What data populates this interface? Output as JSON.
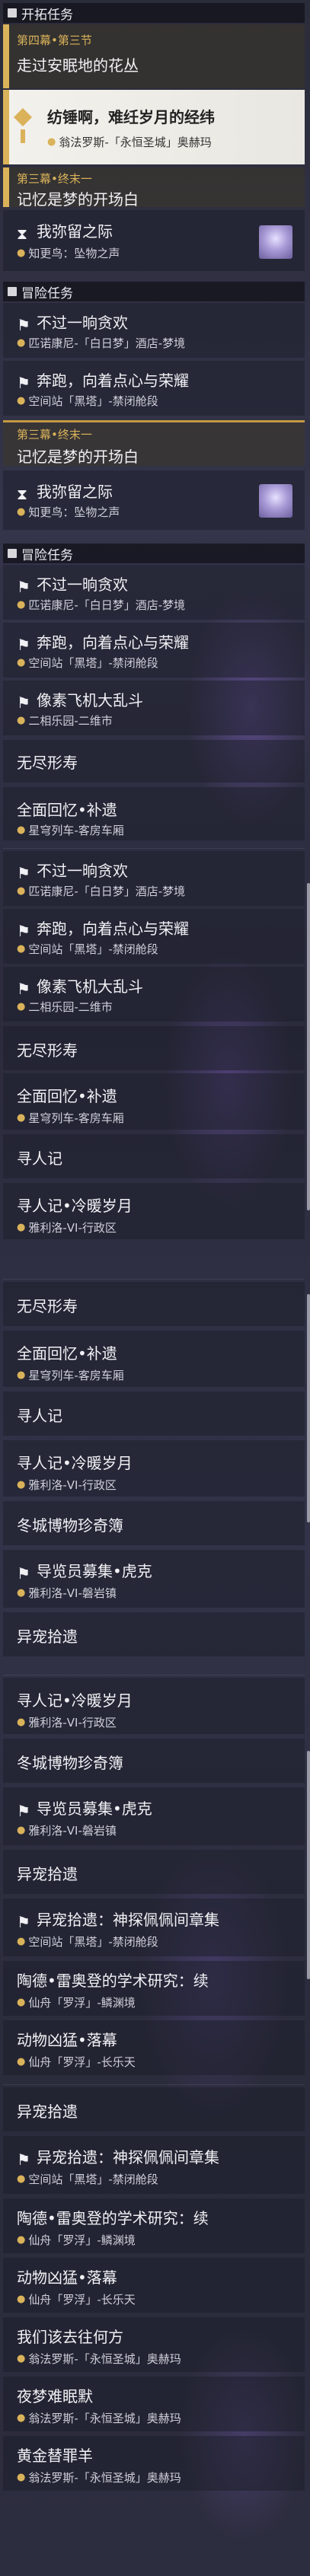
{
  "sections": {
    "trailblaze": "开拓任务",
    "adventure": "冒险任务"
  },
  "trailblaze": {
    "act_prefix": "第四幕•第三节",
    "act_title": "走过安眠地的花丛",
    "selected_title": "纺锤啊，难纴岁月的经纬",
    "selected_loc": "翁法罗斯-「永恒圣城」奥赫玛",
    "act3_prefix": "第三幕•终末一",
    "act3_title": "记忆是梦的开场白",
    "forget_title": "我弥留之际",
    "forget_loc": "知更鸟：坠物之声"
  },
  "adv": {
    "greedy_title": "不过一晌贪欢",
    "greedy_loc": "匹诺康尼-「白日梦」酒店-梦境",
    "run_title": "奔跑，向着点心与荣耀",
    "run_loc": "空间站「黑塔」-禁闭舱段",
    "plane_title": "像素飞机大乱斗",
    "plane_loc": "二相乐园-二维市",
    "endless_title": "无尽形寿",
    "memory_title": "全面回忆•补遗",
    "memory_loc": "星穹列车-客房车厢",
    "seeker_title": "寻人记",
    "seeker_sub_title": "寻人记•冷暖岁月",
    "seeker_loc": "雅利洛-VI-行政区",
    "museum_title": "冬城博物珍奇簿",
    "guide_title": "导览员募集•虎克",
    "guide_loc": "雅利洛-VI-磐岩镇",
    "pet_title": "异宠拾遗",
    "pet_sub_title": "异宠拾遗：神探佩佩间章集",
    "pet_loc": "空间站「黑塔」-禁闭舱段",
    "tao_title": "陶德•雷奥登的学术研究：续",
    "tao_loc": "仙舟「罗浮」-鳞渊境",
    "animal_title": "动物凶猛•落幕",
    "animal_loc": "仙舟「罗浮」-长乐天",
    "where_title": "我们该去往何方",
    "where_loc": "翁法罗斯-「永恒圣城」奥赫玛",
    "night_title": "夜梦难眠默",
    "night_loc": "翁法罗斯-「永恒圣城」奥赫玛",
    "golden_title": "黄金替罪羊",
    "golden_loc": "翁法罗斯-「永恒圣城」奥赫玛"
  }
}
